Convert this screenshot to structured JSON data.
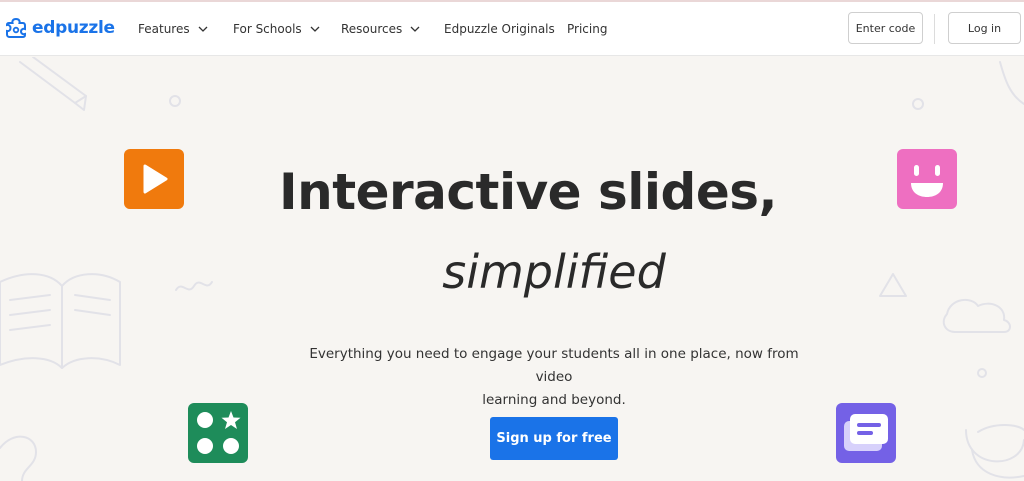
{
  "brand": {
    "name": "edpuzzle",
    "color": "#1a73e8"
  },
  "nav": {
    "items": [
      {
        "label": "Features",
        "has_dropdown": true
      },
      {
        "label": "For Schools",
        "has_dropdown": true
      },
      {
        "label": "Resources",
        "has_dropdown": true
      },
      {
        "label": "Edpuzzle Originals",
        "has_dropdown": false
      },
      {
        "label": "Pricing",
        "has_dropdown": false
      }
    ],
    "enter_code": "Enter code",
    "log_in": "Log in"
  },
  "hero": {
    "title": "Interactive slides,",
    "subtitle": "simplified",
    "description_line1": "Everything you need to engage your students all in one place, now from video",
    "description_line2": "learning and beyond.",
    "cta": "Sign up for free"
  },
  "tiles": [
    {
      "icon": "play-icon",
      "color": "#f07a0d"
    },
    {
      "icon": "smile-icon",
      "color": "#ee6fc1"
    },
    {
      "icon": "shapes-icon",
      "color": "#1e8c5a"
    },
    {
      "icon": "slides-icon",
      "color": "#7461e6"
    }
  ]
}
